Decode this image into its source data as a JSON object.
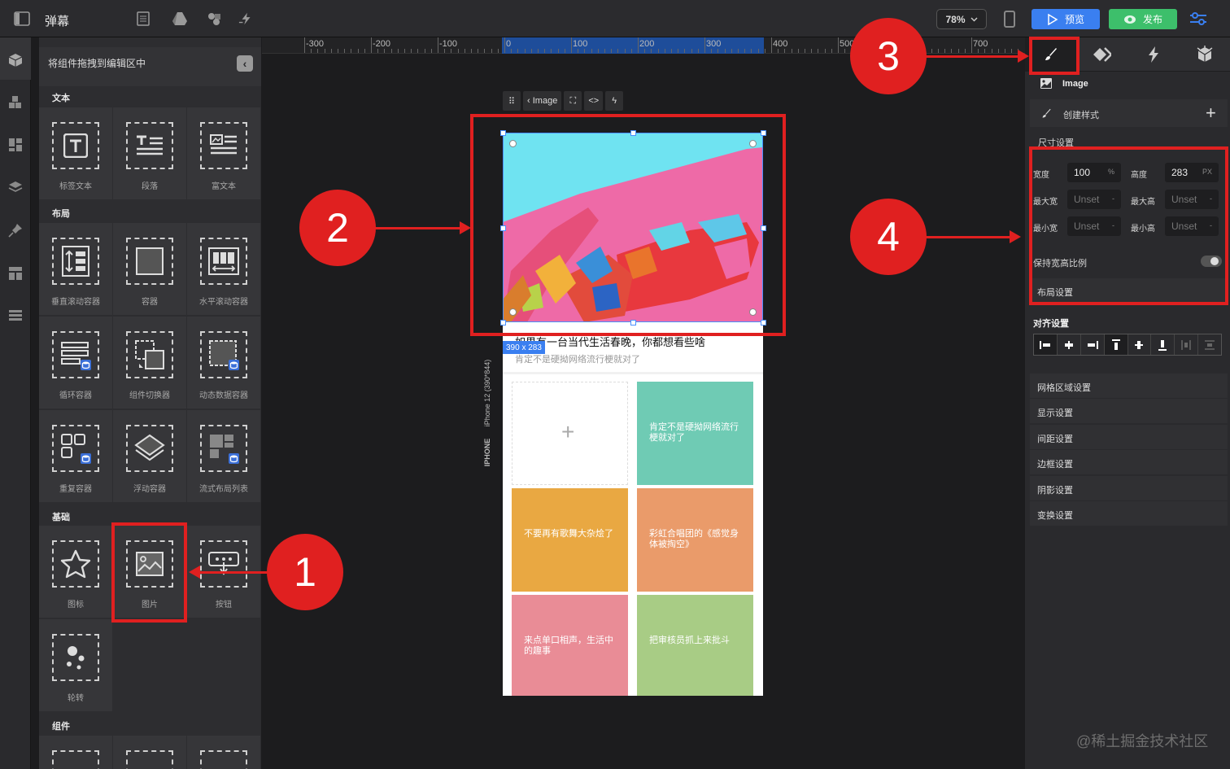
{
  "topbar": {
    "title": "弹幕",
    "zoom": "78%",
    "preview_label": "预览",
    "publish_label": "发布"
  },
  "left_panel": {
    "header": "将组件拖拽到编辑区中",
    "sections": {
      "text": "文本",
      "layout": "布局",
      "basic": "基础",
      "components": "组件"
    },
    "tiles": {
      "label_text": "标签文本",
      "paragraph": "段落",
      "rich_text": "富文本",
      "vscroll": "垂直滚动容器",
      "container": "容器",
      "hscroll": "水平滚动容器",
      "loop": "循环容器",
      "switcher": "组件切换器",
      "dynamic": "动态数据容器",
      "repeat": "重复容器",
      "float": "浮动容器",
      "flow": "流式布局列表",
      "icon": "图标",
      "image": "图片",
      "button": "按钮",
      "carousel": "轮转"
    }
  },
  "ruler": {
    "labels": [
      "-300",
      "-200",
      "-100",
      "0",
      "100",
      "200",
      "300",
      "400",
      "500",
      "700"
    ]
  },
  "canvas": {
    "float_toolbar": {
      "image_label": "Image"
    },
    "dim_badge": "390 x 283",
    "device_label": "iPhone 12 (390*844)",
    "device_type": "IPHONE",
    "article_title": "如果有一台当代生活春晚，你都想看些啥",
    "article_sub": "肯定不是硬拗网络流行梗就对了",
    "cards": [
      {
        "text": "",
        "color": "#ffffff"
      },
      {
        "text": "肯定不是硬拗网络流行梗就对了",
        "color": "#6fcbb4"
      },
      {
        "text": "不要再有歌舞大杂烩了",
        "color": "#e9a842"
      },
      {
        "text": "彩虹合唱团的《感觉身体被掏空》",
        "color": "#ea9b6a"
      },
      {
        "text": "来点单口相声，生活中的趣事",
        "color": "#e98c96"
      },
      {
        "text": "把审核员抓上来批斗",
        "color": "#a8cc85"
      }
    ]
  },
  "annotations": {
    "n1": "1",
    "n2": "2",
    "n3": "3",
    "n4": "4"
  },
  "right_panel": {
    "component_name": "Image",
    "create_style": "创建样式",
    "size_section": "尺寸设置",
    "width_label": "宽度",
    "width_value": "100",
    "width_unit": "%",
    "height_label": "高度",
    "height_value": "283",
    "height_unit": "PX",
    "max_width_label": "最大宽",
    "max_width_value": "Unset",
    "max_height_label": "最大高",
    "max_height_value": "Unset",
    "min_width_label": "最小宽",
    "min_width_value": "Unset",
    "min_height_label": "最小高",
    "min_height_value": "Unset",
    "unit_dash": "-",
    "keep_ratio": "保持宽高比例",
    "layout_section": "布局设置",
    "align_section": "对齐设置",
    "sections": [
      "网格区域设置",
      "显示设置",
      "间距设置",
      "边框设置",
      "阴影设置",
      "变换设置"
    ]
  },
  "watermark": "@稀土掘金技术社区"
}
